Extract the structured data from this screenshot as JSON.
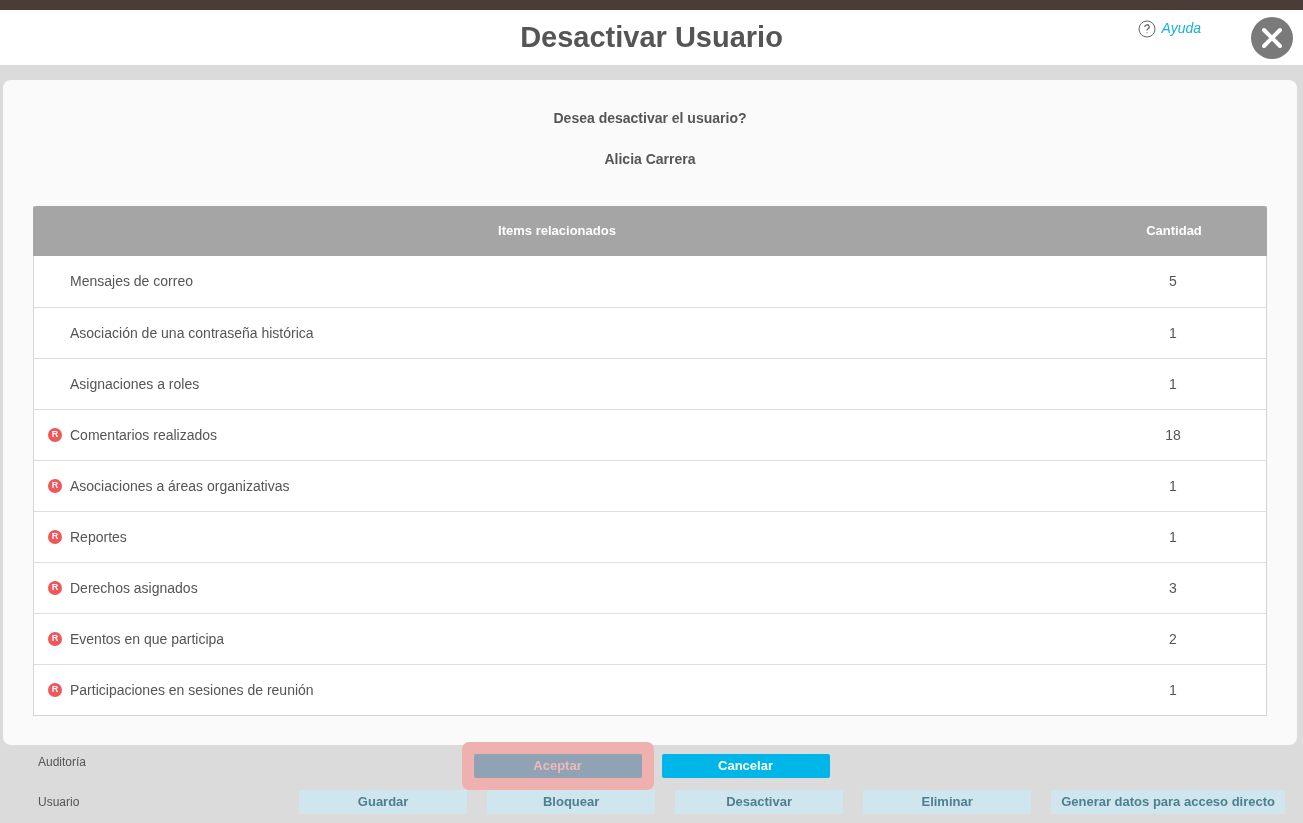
{
  "dialog": {
    "title": "Desactivar Usuario",
    "help": "Ayuda",
    "question": "Desea desactivar el usuario?",
    "user": "Alicia Carrera"
  },
  "table": {
    "columns": [
      "Items relacionados",
      "Cantidad"
    ],
    "rows": [
      {
        "item": "Mensajes de correo",
        "count": "5"
      },
      {
        "item": "Asociación de una contraseña histórica",
        "count": "1"
      },
      {
        "item": "Asignaciones a roles",
        "count": "1"
      },
      {
        "badge": "R",
        "item": "Comentarios realizados",
        "count": "18"
      },
      {
        "badge": "R",
        "item": "Asociaciones a áreas organizativas",
        "count": "1"
      },
      {
        "badge": "R",
        "item": "Reportes",
        "count": "1"
      },
      {
        "badge": "R",
        "item": "Derechos asignados",
        "count": "3"
      },
      {
        "badge": "R",
        "item": "Eventos en que participa",
        "count": "2"
      },
      {
        "badge": "R",
        "item": "Participaciones en sesiones de reunión",
        "count": "1"
      }
    ]
  },
  "buttons": [
    {
      "label": "Aceptar",
      "kind": "primary",
      "disabled": true,
      "highlighted": true
    },
    {
      "label": "Cancelar",
      "kind": "secondary",
      "disabled": false,
      "highlighted": false
    }
  ],
  "background": {
    "dropdowns": [
      "Auditoría",
      "Usuario"
    ],
    "buttons": [
      "Guardar",
      "Bloquear",
      "Desactivar",
      "Eliminar",
      "Generar datos para acceso directo"
    ]
  }
}
